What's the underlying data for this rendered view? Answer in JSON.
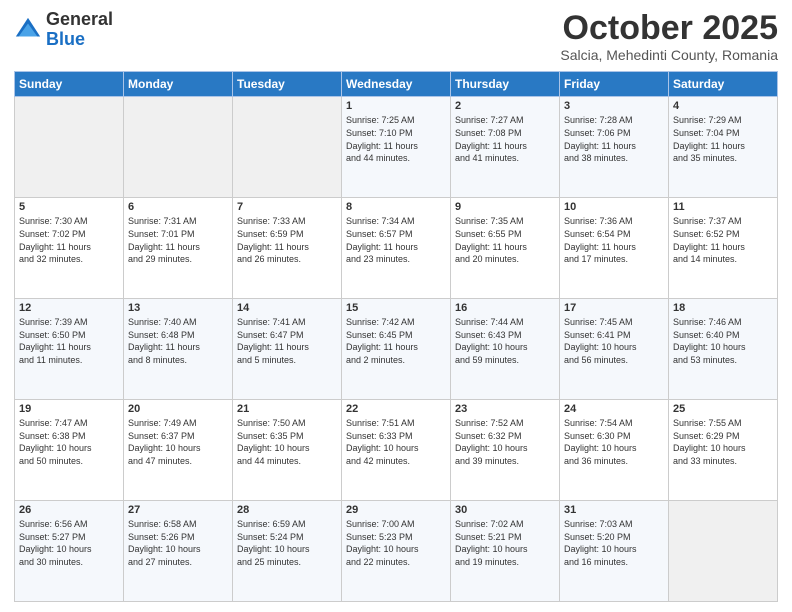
{
  "header": {
    "logo": {
      "line1": "General",
      "line2": "Blue"
    },
    "title": "October 2025",
    "subtitle": "Salcia, Mehedinti County, Romania"
  },
  "weekdays": [
    "Sunday",
    "Monday",
    "Tuesday",
    "Wednesday",
    "Thursday",
    "Friday",
    "Saturday"
  ],
  "weeks": [
    [
      {
        "day": "",
        "info": ""
      },
      {
        "day": "",
        "info": ""
      },
      {
        "day": "",
        "info": ""
      },
      {
        "day": "1",
        "info": "Sunrise: 7:25 AM\nSunset: 7:10 PM\nDaylight: 11 hours\nand 44 minutes."
      },
      {
        "day": "2",
        "info": "Sunrise: 7:27 AM\nSunset: 7:08 PM\nDaylight: 11 hours\nand 41 minutes."
      },
      {
        "day": "3",
        "info": "Sunrise: 7:28 AM\nSunset: 7:06 PM\nDaylight: 11 hours\nand 38 minutes."
      },
      {
        "day": "4",
        "info": "Sunrise: 7:29 AM\nSunset: 7:04 PM\nDaylight: 11 hours\nand 35 minutes."
      }
    ],
    [
      {
        "day": "5",
        "info": "Sunrise: 7:30 AM\nSunset: 7:02 PM\nDaylight: 11 hours\nand 32 minutes."
      },
      {
        "day": "6",
        "info": "Sunrise: 7:31 AM\nSunset: 7:01 PM\nDaylight: 11 hours\nand 29 minutes."
      },
      {
        "day": "7",
        "info": "Sunrise: 7:33 AM\nSunset: 6:59 PM\nDaylight: 11 hours\nand 26 minutes."
      },
      {
        "day": "8",
        "info": "Sunrise: 7:34 AM\nSunset: 6:57 PM\nDaylight: 11 hours\nand 23 minutes."
      },
      {
        "day": "9",
        "info": "Sunrise: 7:35 AM\nSunset: 6:55 PM\nDaylight: 11 hours\nand 20 minutes."
      },
      {
        "day": "10",
        "info": "Sunrise: 7:36 AM\nSunset: 6:54 PM\nDaylight: 11 hours\nand 17 minutes."
      },
      {
        "day": "11",
        "info": "Sunrise: 7:37 AM\nSunset: 6:52 PM\nDaylight: 11 hours\nand 14 minutes."
      }
    ],
    [
      {
        "day": "12",
        "info": "Sunrise: 7:39 AM\nSunset: 6:50 PM\nDaylight: 11 hours\nand 11 minutes."
      },
      {
        "day": "13",
        "info": "Sunrise: 7:40 AM\nSunset: 6:48 PM\nDaylight: 11 hours\nand 8 minutes."
      },
      {
        "day": "14",
        "info": "Sunrise: 7:41 AM\nSunset: 6:47 PM\nDaylight: 11 hours\nand 5 minutes."
      },
      {
        "day": "15",
        "info": "Sunrise: 7:42 AM\nSunset: 6:45 PM\nDaylight: 11 hours\nand 2 minutes."
      },
      {
        "day": "16",
        "info": "Sunrise: 7:44 AM\nSunset: 6:43 PM\nDaylight: 10 hours\nand 59 minutes."
      },
      {
        "day": "17",
        "info": "Sunrise: 7:45 AM\nSunset: 6:41 PM\nDaylight: 10 hours\nand 56 minutes."
      },
      {
        "day": "18",
        "info": "Sunrise: 7:46 AM\nSunset: 6:40 PM\nDaylight: 10 hours\nand 53 minutes."
      }
    ],
    [
      {
        "day": "19",
        "info": "Sunrise: 7:47 AM\nSunset: 6:38 PM\nDaylight: 10 hours\nand 50 minutes."
      },
      {
        "day": "20",
        "info": "Sunrise: 7:49 AM\nSunset: 6:37 PM\nDaylight: 10 hours\nand 47 minutes."
      },
      {
        "day": "21",
        "info": "Sunrise: 7:50 AM\nSunset: 6:35 PM\nDaylight: 10 hours\nand 44 minutes."
      },
      {
        "day": "22",
        "info": "Sunrise: 7:51 AM\nSunset: 6:33 PM\nDaylight: 10 hours\nand 42 minutes."
      },
      {
        "day": "23",
        "info": "Sunrise: 7:52 AM\nSunset: 6:32 PM\nDaylight: 10 hours\nand 39 minutes."
      },
      {
        "day": "24",
        "info": "Sunrise: 7:54 AM\nSunset: 6:30 PM\nDaylight: 10 hours\nand 36 minutes."
      },
      {
        "day": "25",
        "info": "Sunrise: 7:55 AM\nSunset: 6:29 PM\nDaylight: 10 hours\nand 33 minutes."
      }
    ],
    [
      {
        "day": "26",
        "info": "Sunrise: 6:56 AM\nSunset: 5:27 PM\nDaylight: 10 hours\nand 30 minutes."
      },
      {
        "day": "27",
        "info": "Sunrise: 6:58 AM\nSunset: 5:26 PM\nDaylight: 10 hours\nand 27 minutes."
      },
      {
        "day": "28",
        "info": "Sunrise: 6:59 AM\nSunset: 5:24 PM\nDaylight: 10 hours\nand 25 minutes."
      },
      {
        "day": "29",
        "info": "Sunrise: 7:00 AM\nSunset: 5:23 PM\nDaylight: 10 hours\nand 22 minutes."
      },
      {
        "day": "30",
        "info": "Sunrise: 7:02 AM\nSunset: 5:21 PM\nDaylight: 10 hours\nand 19 minutes."
      },
      {
        "day": "31",
        "info": "Sunrise: 7:03 AM\nSunset: 5:20 PM\nDaylight: 10 hours\nand 16 minutes."
      },
      {
        "day": "",
        "info": ""
      }
    ]
  ]
}
